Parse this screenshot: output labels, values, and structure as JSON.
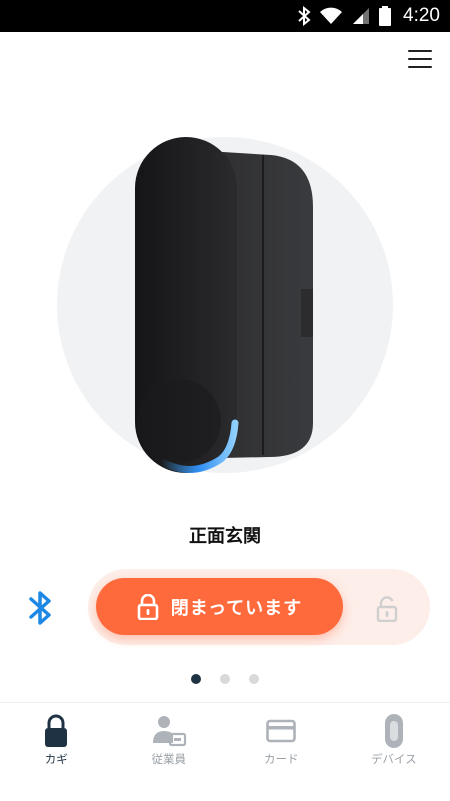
{
  "status_bar": {
    "time": "4:20"
  },
  "device": {
    "name": "正面玄関"
  },
  "lock_control": {
    "state_label": "閉まっています"
  },
  "pager": {
    "count": 3,
    "active_index": 0
  },
  "bottom_nav": {
    "items": [
      {
        "label": "カギ",
        "icon": "key-lock-icon",
        "active": true
      },
      {
        "label": "従業員",
        "icon": "employee-icon",
        "active": false
      },
      {
        "label": "カード",
        "icon": "card-icon",
        "active": false
      },
      {
        "label": "デバイス",
        "icon": "device-icon",
        "active": false
      }
    ]
  },
  "colors": {
    "accent": "#ff6a3d",
    "accent_track": "#fdeee9",
    "bluetooth": "#1e88e5",
    "nav_active": "#1f3244",
    "nav_inactive": "#9aa0a6"
  }
}
